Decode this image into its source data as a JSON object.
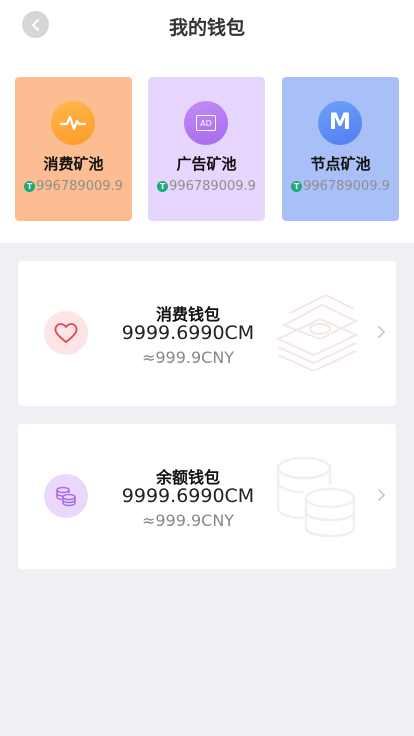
{
  "header": {
    "title": "我的钱包"
  },
  "pools": [
    {
      "name": "消费矿池",
      "value": "996789009.9",
      "icon": "pulse-icon",
      "bg": "#fbbd91",
      "icon_color": "#fca739"
    },
    {
      "name": "广告矿池",
      "value": "996789009.9",
      "icon": "ad-icon",
      "icon_text": "AD",
      "bg": "#e6d5fd",
      "icon_color": "#b07bf0"
    },
    {
      "name": "节点矿池",
      "value": "996789009.9",
      "icon": "m-icon",
      "icon_text": "M",
      "bg": "#a9bff7",
      "icon_color": "#5a8af4"
    }
  ],
  "token_icon_text": "T",
  "wallets": [
    {
      "title": "消费钱包",
      "amount": "9999.6990CM",
      "cny": "≈999.9CNY",
      "icon": "heart-icon"
    },
    {
      "title": "余额钱包",
      "amount": "9999.6990CM",
      "cny": "≈999.9CNY",
      "icon": "coins-icon"
    }
  ]
}
